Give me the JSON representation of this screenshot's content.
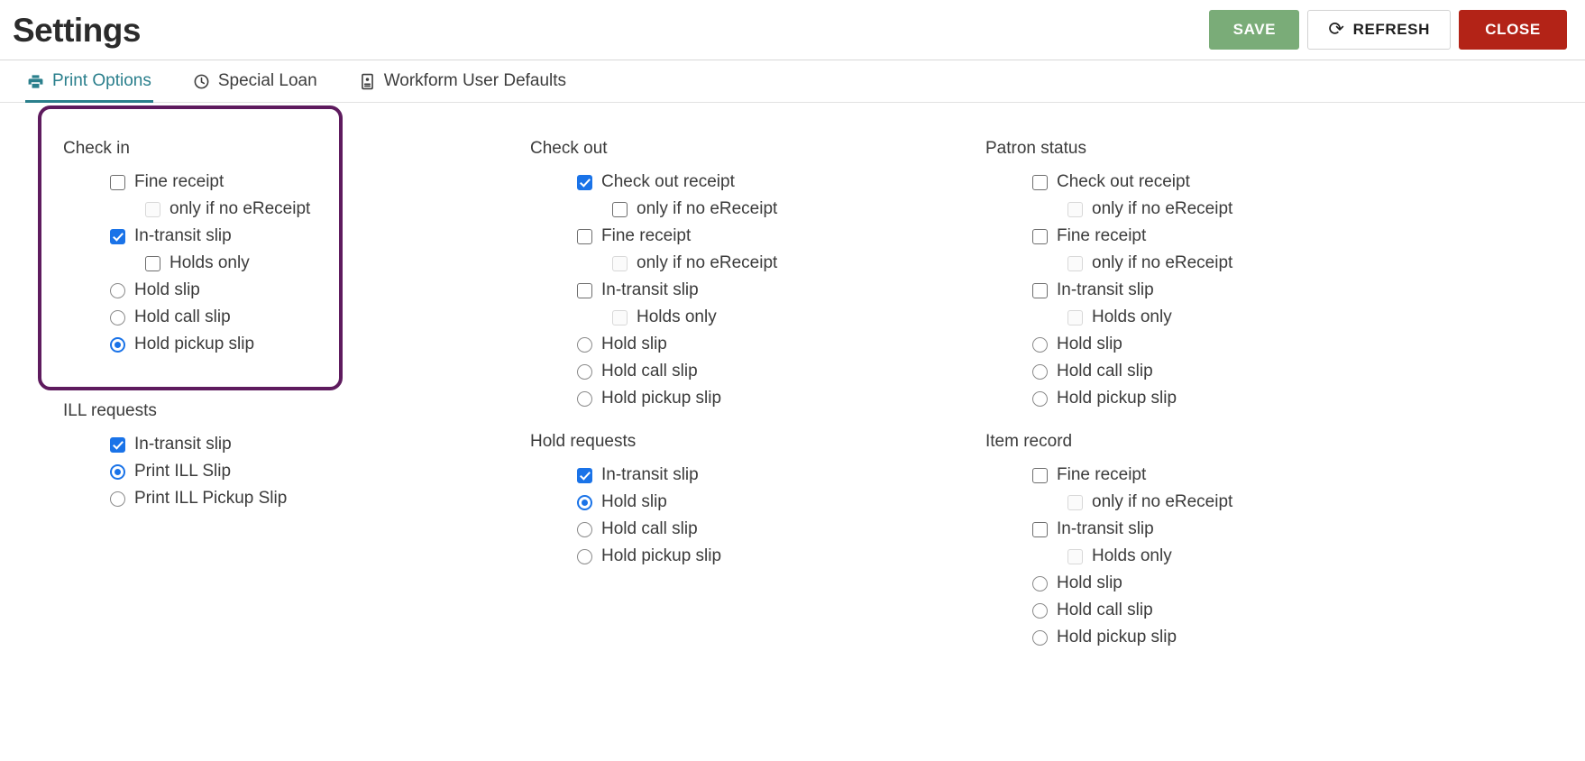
{
  "header": {
    "title": "Settings",
    "buttons": {
      "save": "SAVE",
      "refresh": "REFRESH",
      "close": "CLOSE",
      "refresh_icon": "refresh-icon"
    },
    "colors": {
      "save_bg": "#7aac78",
      "close_bg": "#b32317",
      "refresh_border": "#d2d2d2",
      "accent": "#2a7f8c",
      "highlight_border": "#5e1b5e",
      "control_checked": "#1a73e8"
    }
  },
  "tabs": [
    {
      "label": "Print Options",
      "icon": "printer-icon",
      "active": true
    },
    {
      "label": "Special Loan",
      "icon": "clock-icon",
      "active": false
    },
    {
      "label": "Workform User Defaults",
      "icon": "id-card-icon",
      "active": false
    }
  ],
  "groups": {
    "check_in": {
      "title": "Check in",
      "options": [
        {
          "label": "Fine receipt",
          "type": "checkbox",
          "checked": false,
          "indent": 1,
          "disabled": false
        },
        {
          "label": "only if no eReceipt",
          "type": "checkbox",
          "checked": false,
          "indent": 2,
          "disabled": true
        },
        {
          "label": "In-transit slip",
          "type": "checkbox",
          "checked": true,
          "indent": 1,
          "disabled": false
        },
        {
          "label": "Holds only",
          "type": "checkbox",
          "checked": false,
          "indent": 2,
          "disabled": false
        },
        {
          "label": "Hold slip",
          "type": "radio",
          "checked": false,
          "indent": 1,
          "disabled": false
        },
        {
          "label": "Hold call slip",
          "type": "radio",
          "checked": false,
          "indent": 1,
          "disabled": false
        },
        {
          "label": "Hold pickup slip",
          "type": "radio",
          "checked": true,
          "indent": 1,
          "disabled": false
        }
      ]
    },
    "check_out": {
      "title": "Check out",
      "options": [
        {
          "label": "Check out receipt",
          "type": "checkbox",
          "checked": true,
          "indent": 1,
          "disabled": false
        },
        {
          "label": "only if no eReceipt",
          "type": "checkbox",
          "checked": false,
          "indent": 2,
          "disabled": false
        },
        {
          "label": "Fine receipt",
          "type": "checkbox",
          "checked": false,
          "indent": 1,
          "disabled": false
        },
        {
          "label": "only if no eReceipt",
          "type": "checkbox",
          "checked": false,
          "indent": 2,
          "disabled": true
        },
        {
          "label": "In-transit slip",
          "type": "checkbox",
          "checked": false,
          "indent": 1,
          "disabled": false
        },
        {
          "label": "Holds only",
          "type": "checkbox",
          "checked": false,
          "indent": 2,
          "disabled": true
        },
        {
          "label": "Hold slip",
          "type": "radio",
          "checked": false,
          "indent": 1,
          "disabled": false
        },
        {
          "label": "Hold call slip",
          "type": "radio",
          "checked": false,
          "indent": 1,
          "disabled": false
        },
        {
          "label": "Hold pickup slip",
          "type": "radio",
          "checked": false,
          "indent": 1,
          "disabled": false
        }
      ]
    },
    "patron_status": {
      "title": "Patron status",
      "options": [
        {
          "label": "Check out receipt",
          "type": "checkbox",
          "checked": false,
          "indent": 1,
          "disabled": false
        },
        {
          "label": "only if no eReceipt",
          "type": "checkbox",
          "checked": false,
          "indent": 2,
          "disabled": true
        },
        {
          "label": "Fine receipt",
          "type": "checkbox",
          "checked": false,
          "indent": 1,
          "disabled": false
        },
        {
          "label": "only if no eReceipt",
          "type": "checkbox",
          "checked": false,
          "indent": 2,
          "disabled": true
        },
        {
          "label": "In-transit slip",
          "type": "checkbox",
          "checked": false,
          "indent": 1,
          "disabled": false
        },
        {
          "label": "Holds only",
          "type": "checkbox",
          "checked": false,
          "indent": 2,
          "disabled": true
        },
        {
          "label": "Hold slip",
          "type": "radio",
          "checked": false,
          "indent": 1,
          "disabled": false
        },
        {
          "label": "Hold call slip",
          "type": "radio",
          "checked": false,
          "indent": 1,
          "disabled": false
        },
        {
          "label": "Hold pickup slip",
          "type": "radio",
          "checked": false,
          "indent": 1,
          "disabled": false
        }
      ]
    },
    "ill_requests": {
      "title": "ILL requests",
      "options": [
        {
          "label": "In-transit slip",
          "type": "checkbox",
          "checked": true,
          "indent": 1,
          "disabled": false
        },
        {
          "label": "Print ILL Slip",
          "type": "radio",
          "checked": true,
          "indent": 1,
          "disabled": false
        },
        {
          "label": "Print ILL Pickup Slip",
          "type": "radio",
          "checked": false,
          "indent": 1,
          "disabled": false
        }
      ]
    },
    "hold_requests": {
      "title": "Hold requests",
      "options": [
        {
          "label": "In-transit slip",
          "type": "checkbox",
          "checked": true,
          "indent": 1,
          "disabled": false
        },
        {
          "label": "Hold slip",
          "type": "radio",
          "checked": true,
          "indent": 1,
          "disabled": false
        },
        {
          "label": "Hold call slip",
          "type": "radio",
          "checked": false,
          "indent": 1,
          "disabled": false
        },
        {
          "label": "Hold pickup slip",
          "type": "radio",
          "checked": false,
          "indent": 1,
          "disabled": false
        }
      ]
    },
    "item_record": {
      "title": "Item record",
      "options": [
        {
          "label": "Fine receipt",
          "type": "checkbox",
          "checked": false,
          "indent": 1,
          "disabled": false
        },
        {
          "label": "only if no eReceipt",
          "type": "checkbox",
          "checked": false,
          "indent": 2,
          "disabled": true
        },
        {
          "label": "In-transit slip",
          "type": "checkbox",
          "checked": false,
          "indent": 1,
          "disabled": false
        },
        {
          "label": "Holds only",
          "type": "checkbox",
          "checked": false,
          "indent": 2,
          "disabled": true
        },
        {
          "label": "Hold slip",
          "type": "radio",
          "checked": false,
          "indent": 1,
          "disabled": false
        },
        {
          "label": "Hold call slip",
          "type": "radio",
          "checked": false,
          "indent": 1,
          "disabled": false
        },
        {
          "label": "Hold pickup slip",
          "type": "radio",
          "checked": false,
          "indent": 1,
          "disabled": false
        }
      ]
    }
  }
}
